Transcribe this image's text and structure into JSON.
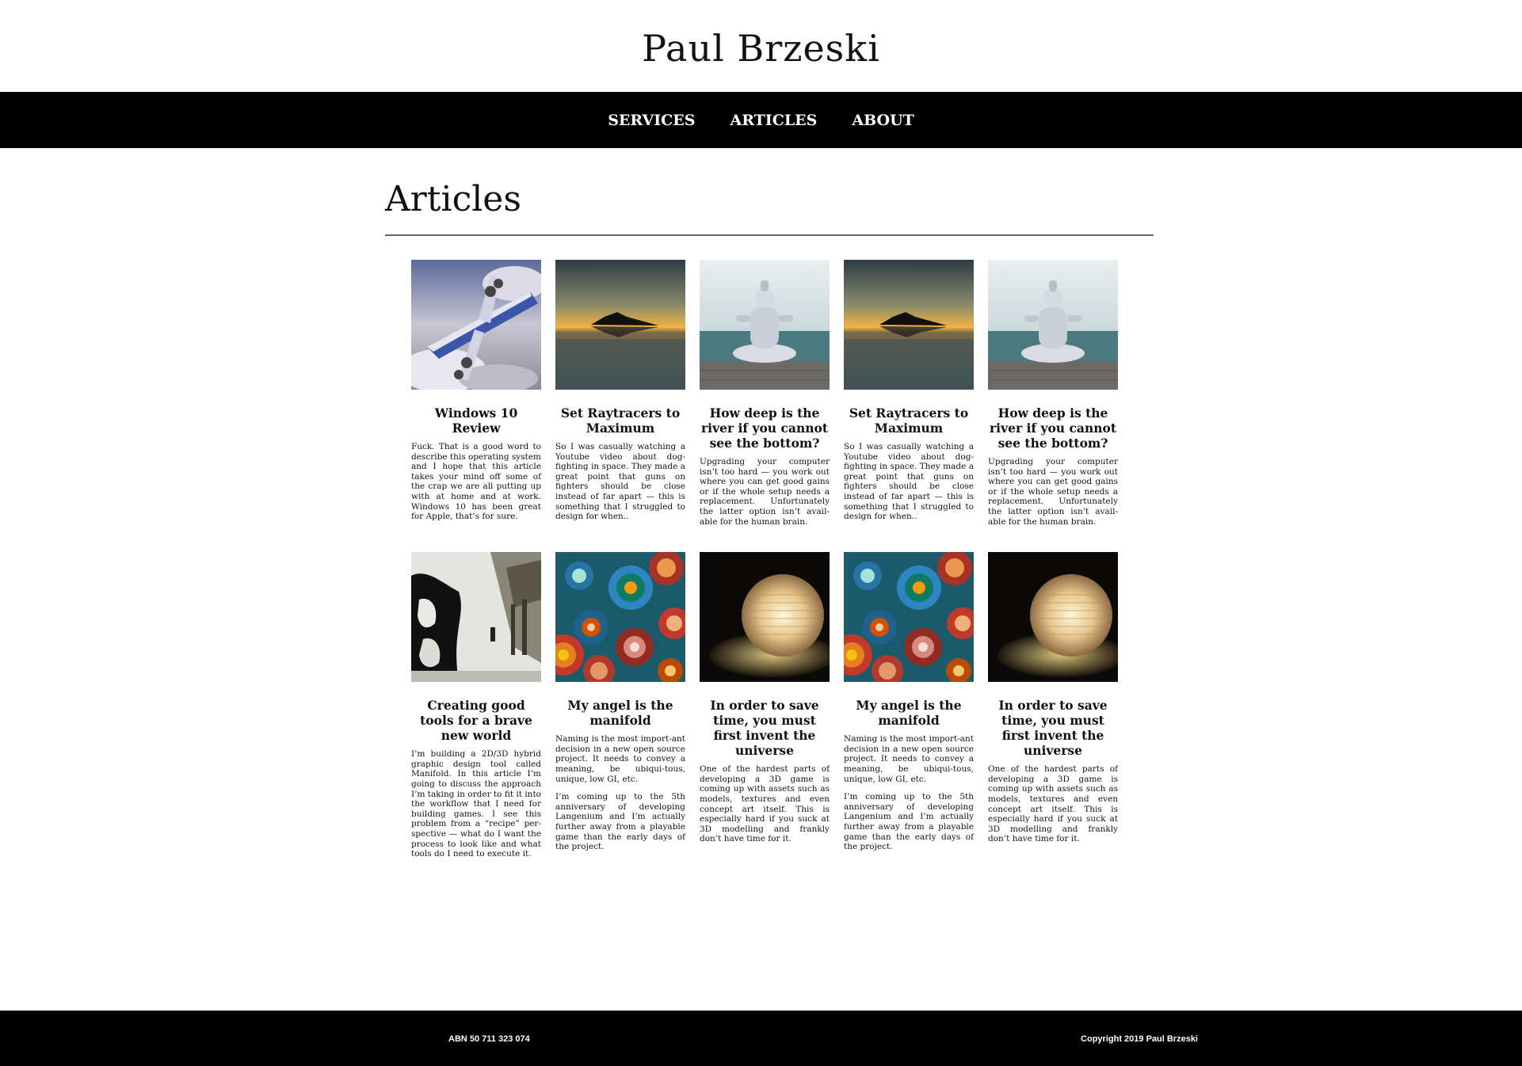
{
  "site": {
    "title": "Paul Brzeski"
  },
  "nav": {
    "items": [
      "SERVICES",
      "ARTICLES",
      "ABOUT"
    ]
  },
  "page": {
    "heading": "Articles"
  },
  "articles": [
    {
      "title": "Windows 10 Review",
      "image": "airplane-image",
      "paragraphs": [
        "Fuck. That is a good word to describe this operating system and I hope that this article takes your mind off some of the crap we are all putting up with at home and at work. Windows 10 has been great for Apple, that’s for sure."
      ]
    },
    {
      "title": "Set Raytracers to Maximum",
      "image": "island-sunset-image",
      "paragraphs": [
        "So I was casually watching a Youtube video about dog-fighting in space. They made a great point that guns on fighters should be close instead of far apart — this is something that I struggled to design for when.."
      ]
    },
    {
      "title": "How deep is the river if you cannot see the bottom?",
      "image": "shiva-statue-image",
      "paragraphs": [
        "Upgrading your computer isn’t too hard — you work out where you can get good gains or if the whole setup needs a replacement. Unfortunately the latter option isn’t avail-able for the human brain."
      ]
    },
    {
      "title": "Set Raytracers to Maximum",
      "image": "island-sunset-image",
      "paragraphs": [
        "So I was casually watching a Youtube video about dog-fighting in space. They made a great point that guns on fighters should be close instead of far apart — this is something that I struggled to design for when.."
      ]
    },
    {
      "title": "How deep is the river if you cannot see the bottom?",
      "image": "shiva-statue-image",
      "paragraphs": [
        "Upgrading your computer isn’t too hard — you work out where you can get good gains or if the whole setup needs a replacement. Unfortunately the latter option isn’t avail-able for the human brain."
      ]
    },
    {
      "title": "Creating good tools for a brave new world",
      "image": "game-scene-image",
      "paragraphs": [
        "I’m building a 2D/3D hybrid graphic design tool called Manifold. In this article I’m going to discuss the approach I’m taking in order to fit it into the workflow that I need for building games. I see this problem from a “recipe” per-spective — what do I want the process to look like and what tools do I need to execute it."
      ]
    },
    {
      "title": "My angel is the manifold",
      "image": "fractal-image",
      "paragraphs": [
        "Naming is the most import-ant decision in a new open source project. It needs to convey a meaning, be ubiqui-tous, unique, low GI, etc.",
        "I’m coming up to the 5th anniversary of developing Langenium and I’m actually further away from a playable game than the early days of the project."
      ]
    },
    {
      "title": "In order to save time, you must first invent the universe",
      "image": "lantern-image",
      "paragraphs": [
        "One of the hardest parts of developing a 3D game is coming up with assets such as models, textures and even concept art itself. This is especially hard if you suck at 3D modelling and frankly don’t have time for it."
      ]
    },
    {
      "title": "My angel is the manifold",
      "image": "fractal-image",
      "paragraphs": [
        "Naming is the most import-ant decision in a new open source project. It needs to convey a meaning, be ubiqui-tous, unique, low GI, etc.",
        "I’m coming up to the 5th anniversary of developing Langenium and I’m actually further away from a playable game than the early days of the project."
      ]
    },
    {
      "title": "In order to save time, you must first invent the universe",
      "image": "lantern-image",
      "paragraphs": [
        "One of the hardest parts of developing a 3D game is coming up with assets such as models, textures and even concept art itself. This is especially hard if you suck at 3D modelling and frankly don’t have time for it."
      ]
    }
  ],
  "footer": {
    "abn": "ABN 50 711 323 074",
    "copyright": "Copyright 2019 Paul Brzeski"
  }
}
